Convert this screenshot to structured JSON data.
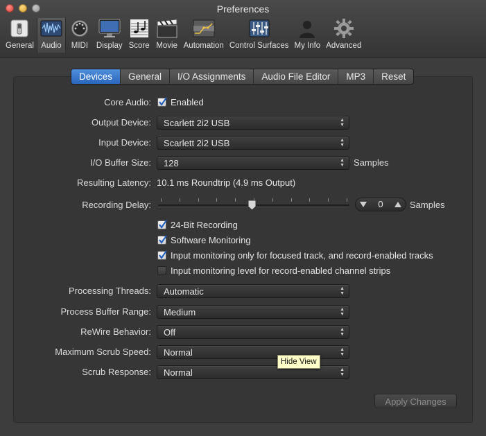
{
  "window": {
    "title": "Preferences"
  },
  "toolbar": [
    {
      "label": "General",
      "icon": "switch-icon",
      "selected": false
    },
    {
      "label": "Audio",
      "icon": "audio-waveform-icon",
      "selected": true
    },
    {
      "label": "MIDI",
      "icon": "midi-connector-icon",
      "selected": false
    },
    {
      "label": "Display",
      "icon": "monitor-icon",
      "selected": false
    },
    {
      "label": "Score",
      "icon": "music-notes-icon",
      "selected": false
    },
    {
      "label": "Movie",
      "icon": "clapperboard-icon",
      "selected": false
    },
    {
      "label": "Automation",
      "icon": "automation-curve-icon",
      "selected": false
    },
    {
      "label": "Control Surfaces",
      "icon": "mixer-faders-icon",
      "selected": false
    },
    {
      "label": "My Info",
      "icon": "user-silhouette-icon",
      "selected": false
    },
    {
      "label": "Advanced",
      "icon": "gear-icon",
      "selected": false
    }
  ],
  "tabs": [
    {
      "label": "Devices",
      "active": true
    },
    {
      "label": "General",
      "active": false
    },
    {
      "label": "I/O Assignments",
      "active": false
    },
    {
      "label": "Audio File Editor",
      "active": false
    },
    {
      "label": "MP3",
      "active": false
    },
    {
      "label": "Reset",
      "active": false
    }
  ],
  "core_audio": {
    "label": "Core Audio:",
    "checkbox_label": "Enabled",
    "checked": true
  },
  "output_device": {
    "label": "Output Device:",
    "value": "Scarlett 2i2 USB"
  },
  "input_device": {
    "label": "Input Device:",
    "value": "Scarlett 2i2 USB"
  },
  "io_buffer": {
    "label": "I/O Buffer Size:",
    "value": "128",
    "suffix": "Samples"
  },
  "latency": {
    "label": "Resulting Latency:",
    "value": "10.1 ms Roundtrip (4.9 ms Output)"
  },
  "recording_delay": {
    "label": "Recording Delay:",
    "value": "0",
    "suffix": "Samples",
    "slider_position": 0.5
  },
  "options": [
    {
      "label": "24-Bit Recording",
      "checked": true
    },
    {
      "label": "Software Monitoring",
      "checked": true
    },
    {
      "label": "Input monitoring only for focused track, and record-enabled tracks",
      "checked": true
    },
    {
      "label": "Input monitoring level for record-enabled channel strips",
      "checked": false
    }
  ],
  "processing_threads": {
    "label": "Processing Threads:",
    "value": "Automatic"
  },
  "process_buffer_range": {
    "label": "Process Buffer Range:",
    "value": "Medium"
  },
  "rewire_behavior": {
    "label": "ReWire Behavior:",
    "value": "Off"
  },
  "max_scrub_speed": {
    "label": "Maximum Scrub Speed:",
    "value": "Normal"
  },
  "scrub_response": {
    "label": "Scrub Response:",
    "value": "Normal"
  },
  "tooltip": {
    "text": "Hide View"
  },
  "apply_button": {
    "label": "Apply Changes",
    "enabled": false
  }
}
